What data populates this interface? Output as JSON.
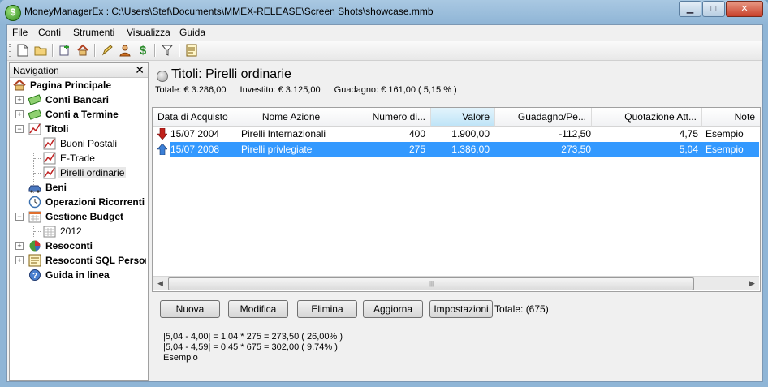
{
  "window": {
    "title": "MoneyManagerEx : C:\\Users\\Stef\\Documents\\MMEX-RELEASE\\Screen Shots\\showcase.mmb",
    "minimize_label": "▁",
    "maximize_label": "□",
    "close_label": "✕"
  },
  "menu": {
    "items": [
      "File",
      "Conti",
      "Strumenti",
      "Visualizza",
      "Guida"
    ]
  },
  "toolbar": {
    "icons": [
      "new-file-icon",
      "open-folder-icon",
      "new-account-icon",
      "home-icon",
      "edit-icon",
      "payee-icon",
      "currency-icon",
      "filter-icon",
      "report-icon"
    ]
  },
  "navigation": {
    "title": "Navigation",
    "close_label": "✕",
    "items": [
      {
        "label": "Pagina Principale",
        "icon": "home-icon",
        "bold": true
      },
      {
        "label": "Conti Bancari",
        "icon": "money-icon",
        "bold": true
      },
      {
        "label": "Conti a Termine",
        "icon": "money-icon",
        "bold": true
      },
      {
        "label": "Titoli",
        "icon": "stocks-icon",
        "bold": true
      },
      {
        "label": "Buoni Postali",
        "icon": "stocks-icon",
        "bold": false
      },
      {
        "label": "E-Trade",
        "icon": "stocks-icon",
        "bold": false
      },
      {
        "label": "Pirelli ordinarie",
        "icon": "stocks-icon",
        "bold": false
      },
      {
        "label": "Beni",
        "icon": "car-icon",
        "bold": true
      },
      {
        "label": "Operazioni Ricorrenti",
        "icon": "clock-icon",
        "bold": true
      },
      {
        "label": "Gestione Budget",
        "icon": "calendar-icon",
        "bold": true
      },
      {
        "label": "2012",
        "icon": "calendar-icon",
        "bold": false
      },
      {
        "label": "Resoconti",
        "icon": "pie-chart-icon",
        "bold": true
      },
      {
        "label": "Resoconti SQL Personalizzati",
        "icon": "report-icon",
        "bold": true
      },
      {
        "label": "Guida in linea",
        "icon": "help-icon",
        "bold": true
      }
    ]
  },
  "main": {
    "title": "Titoli: Pirelli ordinarie",
    "summary": {
      "total": "Totale: € 3.286,00",
      "invested": "Investito: € 3.125,00",
      "gain": "Guadagno: € 161,00  ( 5,15 % )"
    },
    "columns": [
      "Data di Acquisto",
      "Nome Azione",
      "Numero di...",
      "Valore",
      "Guadagno/Pe...",
      "Quotazione Att...",
      "Note"
    ],
    "rows": [
      {
        "date": "15/07 2004",
        "name": "Pirelli Internazionali",
        "qty": "400",
        "value": "1.900,00",
        "gain": "-112,50",
        "price": "4,75",
        "note": "Esempio",
        "trend": "down",
        "selected": false
      },
      {
        "date": "15/07 2008",
        "name": "Pirelli privlegiate",
        "qty": "275",
        "value": "1.386,00",
        "gain": "273,50",
        "price": "5,04",
        "note": "Esempio",
        "trend": "up",
        "selected": true
      }
    ],
    "buttons": {
      "new": "Nuova",
      "edit": "Modifica",
      "delete": "Elimina",
      "refresh": "Aggiorna",
      "settings": "Impostazioni"
    },
    "total_count": "Totale: (675)",
    "info_lines": [
      "|5,04 - 4,00| = 1,04 * 275 = 273,50 ( 26,00% )",
      "|5,04 - 4,59| = 0,45 * 675 = 302,00 ( 9,74% )",
      "Esempio"
    ]
  },
  "colors": {
    "selection": "#3399ff",
    "sorted_header": "#bfe4f7",
    "down_arrow": "#c0201a",
    "up_arrow": "#3b7fd6"
  }
}
